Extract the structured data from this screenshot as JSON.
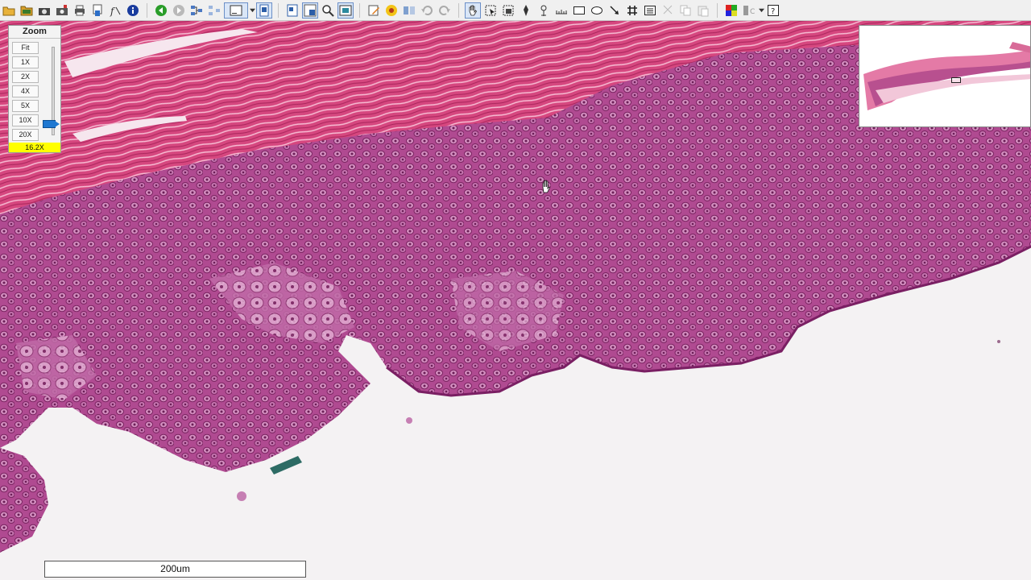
{
  "toolbar": {
    "icons": [
      "open-folder-icon",
      "folder-icon",
      "camera-icon",
      "settings-camera-icon",
      "print-icon",
      "export-icon",
      "function-icon",
      "info-icon",
      "back-icon",
      "forward-icon",
      "network-icon",
      "layout-icon",
      "window-icon",
      "panel-icon",
      "fit-window-icon",
      "magnify-window-icon",
      "zoom-icon",
      "screen-icon",
      "edit-icon",
      "measure-tool-icon",
      "compare-icon",
      "undo-icon",
      "redo-icon",
      "hand-icon",
      "select-icon",
      "snapshot-icon",
      "pen-icon",
      "ruler-icon",
      "ruler-scale-icon",
      "rectangle-icon",
      "ellipse-icon",
      "arrow-icon",
      "grid-icon",
      "list-icon",
      "cut-icon",
      "copy-icon",
      "paste-icon",
      "color-icon",
      "gray-icon",
      "help-icon"
    ]
  },
  "zoom": {
    "title": "Zoom",
    "levels": [
      "Fit",
      "1X",
      "2X",
      "4X",
      "5X",
      "10X",
      "20X"
    ],
    "current": "16.2X",
    "slider_value": 16.2
  },
  "scale_bar": {
    "label": "200um"
  },
  "colors": {
    "stroma_pink": "#d23f83",
    "epithelium_purple": "#b0488f",
    "background": "#f4f2f3",
    "zoom_readout": "#ffff00",
    "slider_blue": "#1f78d1"
  }
}
